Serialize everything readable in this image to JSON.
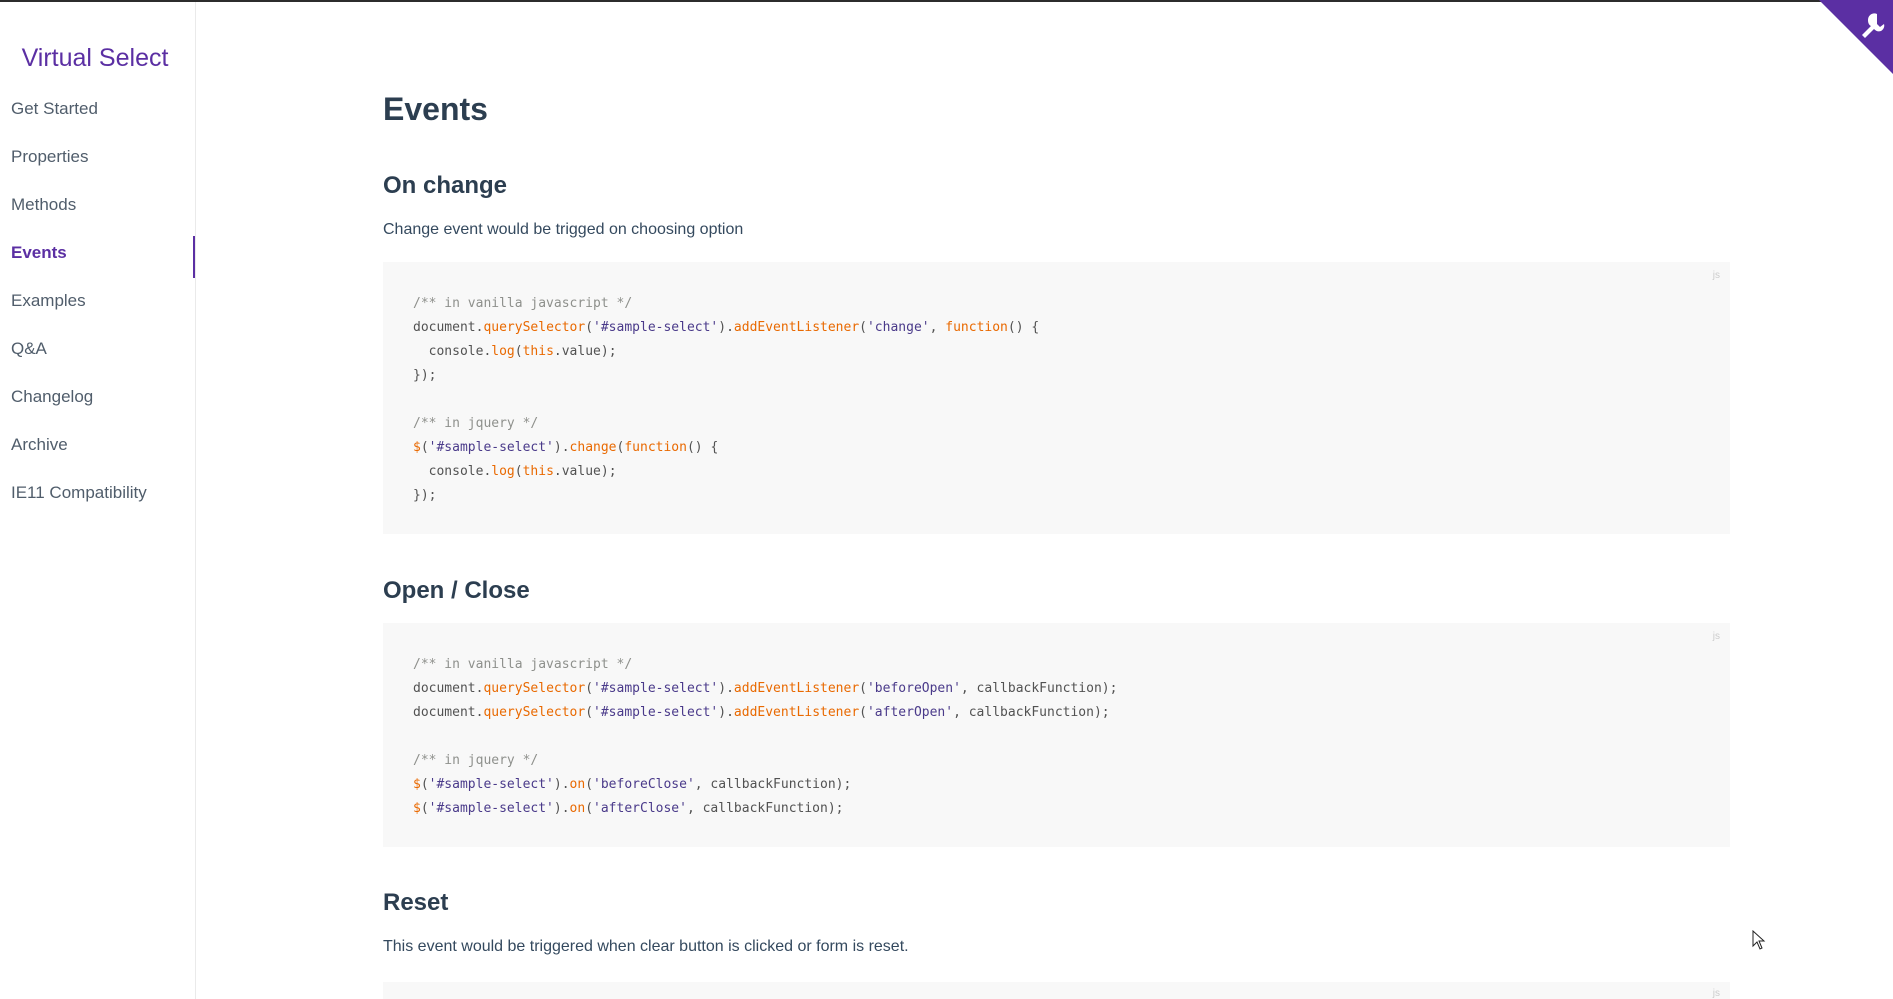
{
  "app": {
    "title": "Virtual Select"
  },
  "sidebar": {
    "items": [
      {
        "label": "Get Started"
      },
      {
        "label": "Properties"
      },
      {
        "label": "Methods"
      },
      {
        "label": "Events",
        "active": true
      },
      {
        "label": "Examples"
      },
      {
        "label": "Q&A"
      },
      {
        "label": "Changelog"
      },
      {
        "label": "Archive"
      },
      {
        "label": "IE11 Compatibility"
      }
    ]
  },
  "main": {
    "title": "Events",
    "sections": [
      {
        "heading": "On change",
        "description": "Change event would be trigged on choosing option",
        "code_lang": "js",
        "code": [
          "/** in vanilla javascript */",
          "document.querySelector('#sample-select').addEventListener('change', function() {",
          "  console.log(this.value);",
          "});",
          "",
          "/** in jquery */",
          "$('#sample-select').change(function() {",
          "  console.log(this.value);",
          "});"
        ]
      },
      {
        "heading": "Open / Close",
        "code_lang": "js",
        "code": [
          "/** in vanilla javascript */",
          "document.querySelector('#sample-select').addEventListener('beforeOpen', callbackFunction);",
          "document.querySelector('#sample-select').addEventListener('afterOpen', callbackFunction);",
          "",
          "/** in jquery */",
          "$('#sample-select').on('beforeClose', callbackFunction);",
          "$('#sample-select').on('afterClose', callbackFunction);"
        ]
      },
      {
        "heading": "Reset",
        "description": "This event would be triggered when clear button is clicked or form is reset.",
        "code_lang": "js"
      }
    ]
  },
  "colors": {
    "accent": "#5b2fa3",
    "code_bg": "#f8f8f8"
  },
  "icons": {
    "corner": "github-corner-icon",
    "cursor": "mouse-cursor-icon"
  }
}
